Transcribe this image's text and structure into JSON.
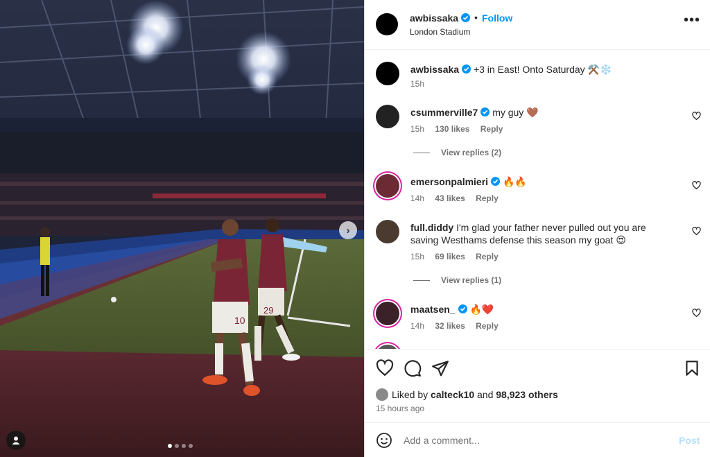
{
  "post": {
    "username": "awbissaka",
    "location": "London Stadium",
    "follow_label": "Follow",
    "separator": "•",
    "more_label": "•••",
    "caption": "+3 in East! Onto Saturday ⚒️❄️",
    "caption_time": "15h",
    "carousel": {
      "count": 4,
      "active_index": 0,
      "next_label": "›"
    }
  },
  "comments": [
    {
      "username": "csummerville7",
      "verified": true,
      "text": "my guy 🤎",
      "time": "15h",
      "likes": "130 likes",
      "reply_label": "Reply",
      "view_replies": "View replies (2)"
    },
    {
      "username": "emersonpalmieri",
      "verified": true,
      "text": "🔥🔥",
      "time": "14h",
      "likes": "43 likes",
      "reply_label": "Reply"
    },
    {
      "username": "full.diddy",
      "verified": false,
      "text": "I'm glad your father never pulled out you are saving Westhams defense this season my goat 😍",
      "time": "15h",
      "likes": "69 likes",
      "reply_label": "Reply",
      "view_replies": "View replies (1)"
    },
    {
      "username": "maatsen_",
      "verified": true,
      "text": "🔥❤️",
      "time": "14h",
      "likes": "32 likes",
      "reply_label": "Reply"
    }
  ],
  "likes": {
    "prefix": "Liked by",
    "user": "calteck10",
    "conj": "and",
    "others": "98,923 others",
    "time_ago": "15 hours ago"
  },
  "add_comment": {
    "placeholder": "Add a comment...",
    "post_label": "Post"
  },
  "colors": {
    "accent": "#0095f6",
    "verified": "#0095f6",
    "post_disabled": "#b2dffc",
    "story_ring": "#d6249f"
  },
  "icons": [
    "heart-icon",
    "comment-icon",
    "share-icon",
    "bookmark-icon",
    "emoji-icon",
    "verified-icon",
    "user-tag-icon",
    "chevron-right-icon"
  ]
}
